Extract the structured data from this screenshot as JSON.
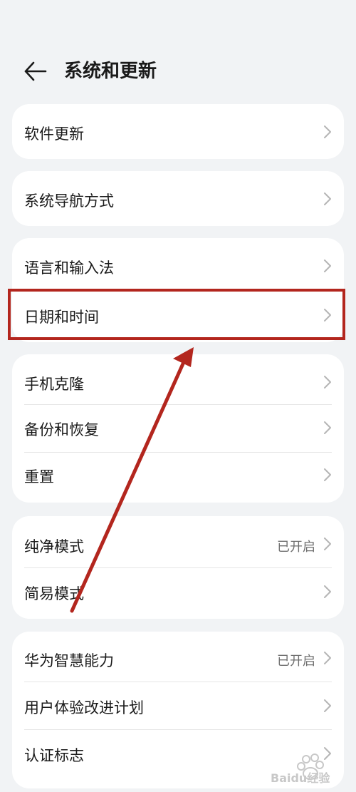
{
  "header": {
    "title": "系统和更新"
  },
  "groups": [
    {
      "items": [
        {
          "label": "软件更新"
        }
      ]
    },
    {
      "items": [
        {
          "label": "系统导航方式"
        }
      ]
    },
    {
      "items": [
        {
          "label": "语言和输入法"
        },
        {
          "label": "日期和时间"
        }
      ]
    },
    {
      "items": [
        {
          "label": "手机克隆"
        },
        {
          "label": "备份和恢复"
        },
        {
          "label": "重置"
        }
      ]
    },
    {
      "items": [
        {
          "label": "纯净模式",
          "value": "已开启"
        },
        {
          "label": "简易模式"
        }
      ]
    },
    {
      "items": [
        {
          "label": "华为智慧能力",
          "value": "已开启"
        },
        {
          "label": "用户体验改进计划"
        },
        {
          "label": "认证标志"
        }
      ]
    }
  ],
  "watermark": {
    "text": "Baidu经验"
  },
  "colors": {
    "annotation": "#b3261e",
    "card": "#ffffff",
    "background": "#f1f3f5"
  }
}
